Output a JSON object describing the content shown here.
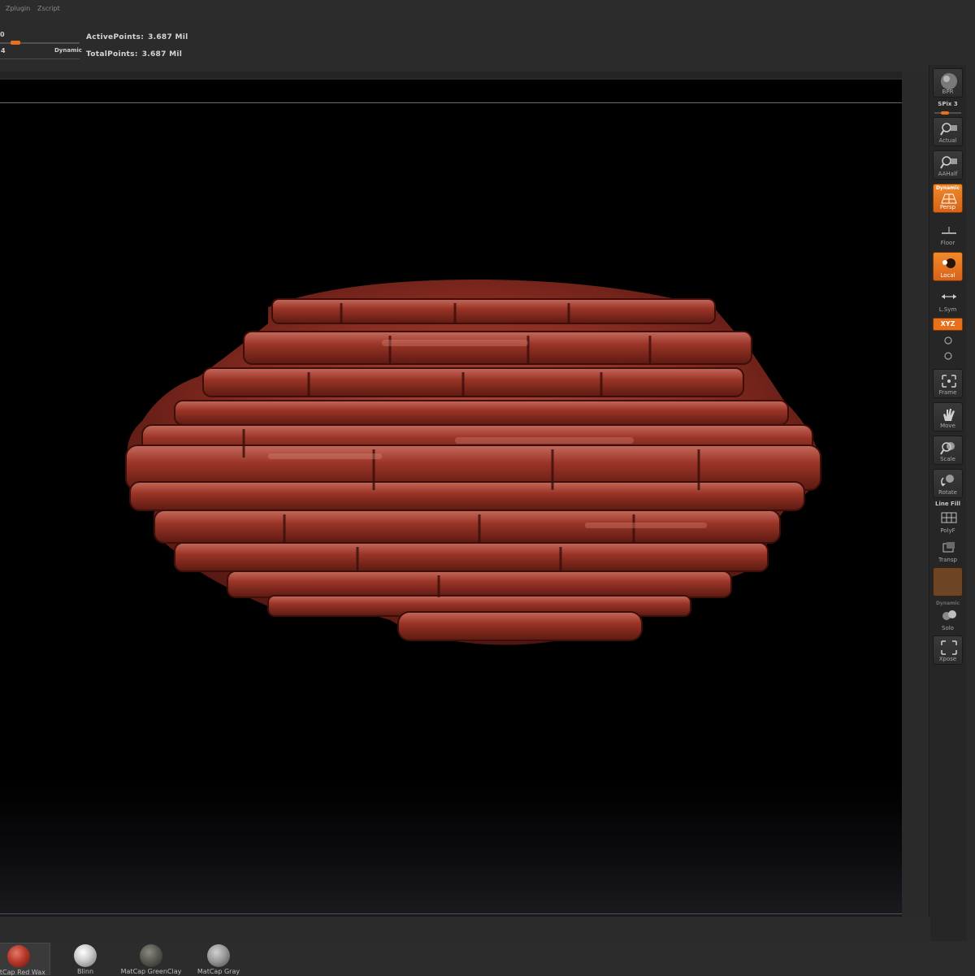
{
  "menu": {
    "items": [
      "Zplugin",
      "Zscript"
    ]
  },
  "info": {
    "top_value": "0",
    "bottom_value": "4",
    "dynamic_label": "Dynamic",
    "active_points_label": "ActivePoints:",
    "active_points_value": "3.687 Mil",
    "total_points_label": "TotalPoints:",
    "total_points_value": "3.687 Mil"
  },
  "shelf": {
    "bpr": "BPR",
    "spix": "SPix 3",
    "actual": "Actual",
    "aahalf": "AAHalf",
    "dynamic_cap": "Dynamic",
    "persp": "Persp",
    "floor": "Floor",
    "local": "Local",
    "lsym": "L.Sym",
    "xyz": "XYZ",
    "frame": "Frame",
    "move": "Move",
    "scale": "Scale",
    "rotate": "Rotate",
    "linefill": "Line Fill",
    "polyf": "PolyF",
    "transp": "Transp",
    "dynamic_small": "Dynamic",
    "solo": "Solo",
    "xpose": "Xpose"
  },
  "materials": [
    {
      "label": "MatCap Red Wax",
      "color": "#b8382a"
    },
    {
      "label": "Blinn",
      "color": "#d8d8d8"
    },
    {
      "label": "MatCap GreenClay",
      "color": "#5a5a52"
    },
    {
      "label": "MatCap Gray",
      "color": "#9a9a9a"
    }
  ],
  "colors": {
    "accent": "#e8701a",
    "model": "#8e2e22"
  }
}
